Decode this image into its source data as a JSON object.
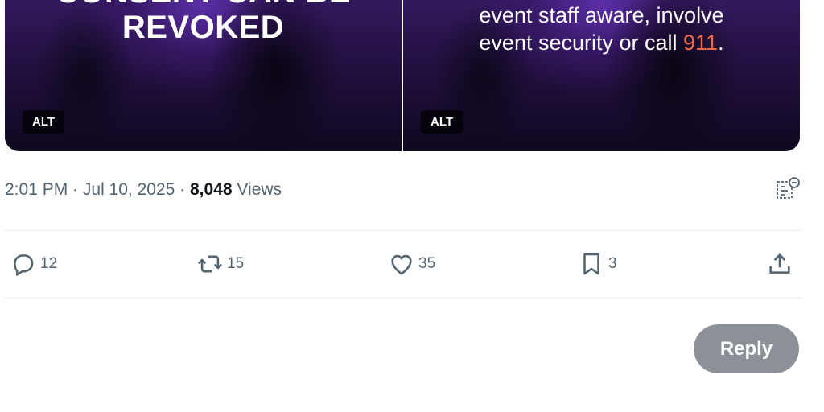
{
  "media": {
    "panel1": {
      "line1": "CONSENT CAN BE",
      "line2": "REVOKED",
      "alt": "ALT"
    },
    "panel2": {
      "line1": "event staff aware, involve",
      "line2_prefix": "event security or call ",
      "line2_highlight": "911",
      "line2_suffix": ".",
      "alt": "ALT"
    }
  },
  "meta": {
    "time": "2:01 PM",
    "separator1": " · ",
    "date": "Jul 10, 2025",
    "separator2": " · ",
    "views_count": "8,048",
    "views_label": " Views"
  },
  "actions": {
    "replies": "12",
    "reposts": "15",
    "likes": "35",
    "bookmarks": "3"
  },
  "reply_button": "Reply",
  "colors": {
    "highlight": "#ef6a4a",
    "reply_button_bg": "#8b9196",
    "muted_text": "#536471"
  },
  "icons": [
    "reply-icon",
    "repost-icon",
    "like-icon",
    "bookmark-icon",
    "share-icon",
    "analytics-icon"
  ]
}
